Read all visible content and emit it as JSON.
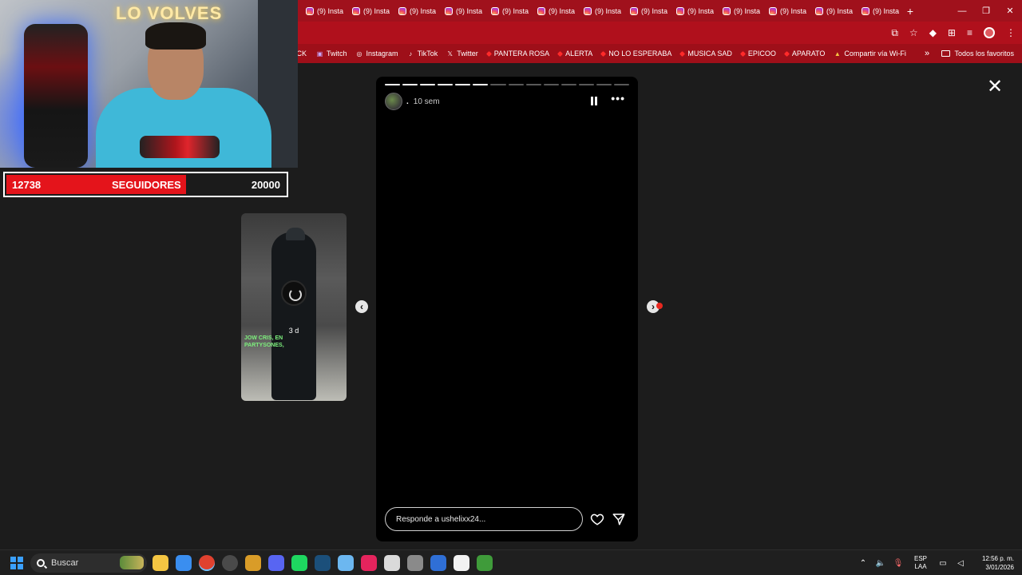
{
  "overlay": {
    "wall_text": "LO VOLVES",
    "followers_current": "12738",
    "followers_label": "SEGUIDORES",
    "followers_goal": "20000",
    "followers_progress_fraction": 0.637
  },
  "browser": {
    "tab_label": "(9) Insta",
    "tab_count": 13,
    "new_tab_symbol": "+",
    "window_controls": [
      "—",
      "❐",
      "✕"
    ],
    "toolbar_icons": [
      "install-icon",
      "star-icon",
      "extension-diamond-icon",
      "puzzle-icon",
      "media-icon",
      "profile-icon",
      "menu-icon"
    ],
    "bookmarks": [
      {
        "label": "ICK",
        "icon": "none"
      },
      {
        "label": "Twitch",
        "icon": "twitch-icon"
      },
      {
        "label": "Instagram",
        "icon": "instagram-icon"
      },
      {
        "label": "TikTok",
        "icon": "tiktok-icon"
      },
      {
        "label": "Twitter",
        "icon": "x-icon"
      },
      {
        "label": "PANTERA ROSA",
        "icon": "youtube-icon"
      },
      {
        "label": "ALERTA",
        "icon": "youtube-icon"
      },
      {
        "label": "NO LO ESPERABA",
        "icon": "youtube-icon"
      },
      {
        "label": "MUSICA SAD",
        "icon": "youtube-icon"
      },
      {
        "label": "EPICOO",
        "icon": "youtube-icon"
      },
      {
        "label": "APARATO",
        "icon": "youtube-icon"
      },
      {
        "label": "Compartir vía Wi-Fi",
        "icon": "warning-icon"
      }
    ],
    "bookmarks_overflow": "»",
    "all_bookmarks": "Todos los favoritos"
  },
  "story": {
    "username": ".",
    "time": "10 sem",
    "segments_total": 14,
    "segments_done": 6,
    "reply_placeholder": "Responde a ushelixx24...",
    "more_symbol": "•••"
  },
  "preview": {
    "age": "3 d",
    "caption": "JOW CRIS, EN\nPARTYSONES,"
  },
  "close_symbol": "✕",
  "taskbar": {
    "search_placeholder": "Buscar",
    "apps": [
      {
        "name": "file-explorer-icon",
        "color": "#f4c542"
      },
      {
        "name": "store-icon",
        "color": "#3a8ef0"
      },
      {
        "name": "chrome-icon",
        "color": "#e0412f"
      },
      {
        "name": "obs-icon",
        "color": "#4a4a4a"
      },
      {
        "name": "folder-green-icon",
        "color": "#d99c28"
      },
      {
        "name": "discord-icon",
        "color": "#5865f2"
      },
      {
        "name": "spotify-icon",
        "color": "#1ed760"
      },
      {
        "name": "steam-icon",
        "color": "#1b4f7a"
      },
      {
        "name": "app-blue-icon",
        "color": "#6cb7f0"
      },
      {
        "name": "tiktok-icon",
        "color": "#e5245d"
      },
      {
        "name": "notepad-icon",
        "color": "#dadada"
      },
      {
        "name": "settings-icon",
        "color": "#8a8a8a"
      },
      {
        "name": "edit-icon",
        "color": "#2f6fd6"
      },
      {
        "name": "capcut-icon",
        "color": "#f2f2f2"
      },
      {
        "name": "minecraft-icon",
        "color": "#3f9b3a"
      }
    ],
    "lang_top": "ESP",
    "lang_bottom": "LAA",
    "time": "12:56 p. m.",
    "date": "3/01/2026"
  }
}
